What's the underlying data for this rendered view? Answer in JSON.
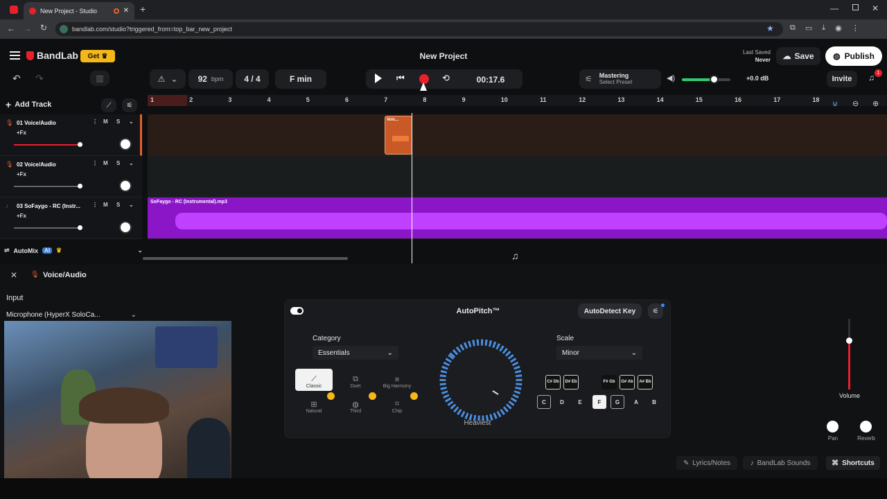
{
  "browser": {
    "tab_title": "New Project - Studio",
    "url": "bandlab.com/studio?triggered_from=top_bar_new_project"
  },
  "header": {
    "brand": "BandLab",
    "get_label": "Get",
    "project_title": "New Project",
    "last_saved_label": "Last Saved",
    "last_saved_value": "Never",
    "save_label": "Save",
    "publish_label": "Publish"
  },
  "transport": {
    "bpm_value": "92",
    "bpm_unit": "bpm",
    "time_sig": "4 / 4",
    "key": "F min",
    "time": "00:17.6",
    "mastering_title": "Mastering",
    "mastering_sub": "Select Preset",
    "volume_db": "+0.0 dB",
    "invite_label": "Invite",
    "notif_count": "1"
  },
  "timeline": {
    "add_track_label": "Add Track",
    "ruler": [
      "1",
      "2",
      "3",
      "4",
      "5",
      "6",
      "7",
      "8",
      "9",
      "10",
      "11",
      "12",
      "13",
      "14",
      "15",
      "16",
      "17",
      "18"
    ]
  },
  "tracks": [
    {
      "name": "01  Voice/Audio",
      "fx": "+Fx",
      "m": "M",
      "s": "S",
      "color": "#e8602c",
      "clip": "Voic..."
    },
    {
      "name": "02  Voice/Audio",
      "fx": "+Fx",
      "m": "M",
      "s": "S",
      "color": "#e8602c"
    },
    {
      "name": "03  SoFaygo - RC (Instr...",
      "fx": "+Fx",
      "m": "M",
      "s": "S",
      "color": "#a020f0",
      "clip": "SoFaygo - RC (Instrumental).mp3"
    }
  ],
  "automix": {
    "label": "AutoMix",
    "ai_badge": "AI"
  },
  "panel": {
    "track_title": "Voice/Audio",
    "input_label": "Input",
    "input_device": "Microphone (HyperX SoloCa..."
  },
  "autopitch": {
    "title": "AutoPitch™",
    "autodetect_label": "AutoDetect Key",
    "category_label": "Category",
    "category_value": "Essentials",
    "scale_label": "Scale",
    "scale_value": "Minor",
    "dial_label": "Heaviest",
    "categories": [
      "Classic",
      "Duet",
      "Big Harmony",
      "Natural",
      "Third",
      "Chip"
    ],
    "black_keys": [
      "C# Db",
      "D# Eb",
      "F# Gb",
      "G# Ab",
      "A# Bb"
    ],
    "white_keys": [
      "C",
      "D",
      "E",
      "F",
      "G",
      "A",
      "B"
    ]
  },
  "mixer": {
    "volume_label": "Volume",
    "pan_label": "Pan",
    "reverb_label": "Reverb"
  },
  "footer": {
    "lyrics_label": "Lyrics/Notes",
    "sounds_label": "BandLab Sounds",
    "shortcuts_label": "Shortcuts"
  },
  "colors": {
    "accent_red": "#e8202c",
    "get_yellow": "#f5b819",
    "purple": "#a020f0",
    "orange": "#e8602c"
  }
}
